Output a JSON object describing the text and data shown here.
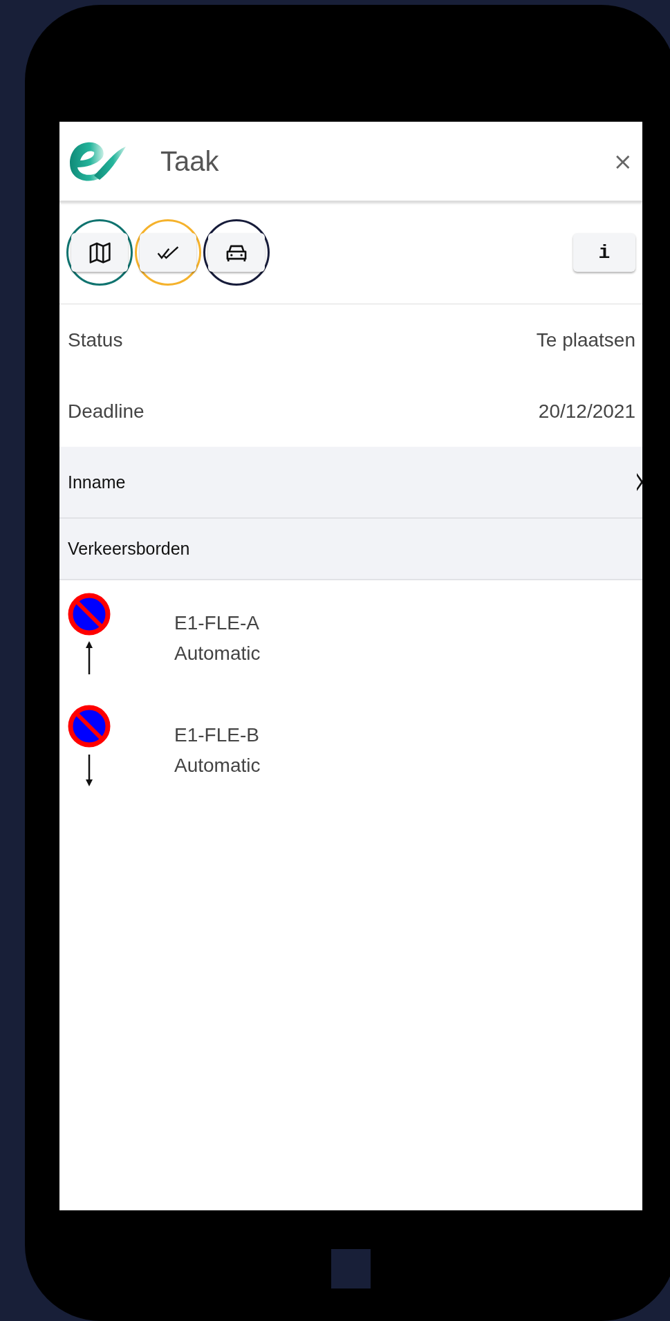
{
  "header": {
    "title": "Taak",
    "close": "×"
  },
  "toolbar": {
    "buttons": [
      {
        "kind": "map",
        "color": "#10736f"
      },
      {
        "kind": "check",
        "color": "#f5b22c"
      },
      {
        "kind": "car",
        "color": "#171c3a"
      }
    ],
    "info": "i"
  },
  "fields": [
    {
      "label": "Status",
      "value": "Te plaatsen"
    },
    {
      "label": "Deadline",
      "value": "20/12/2021"
    }
  ],
  "sections": [
    {
      "title": "Inname",
      "chevron": true
    },
    {
      "title": "Verkeersborden",
      "chevron": false
    }
  ],
  "signs": [
    {
      "kind": "up",
      "code": "E1-FLE-A",
      "mode": "Automatic"
    },
    {
      "kind": "down",
      "code": "E1-FLE-B",
      "mode": "Automatic"
    }
  ]
}
